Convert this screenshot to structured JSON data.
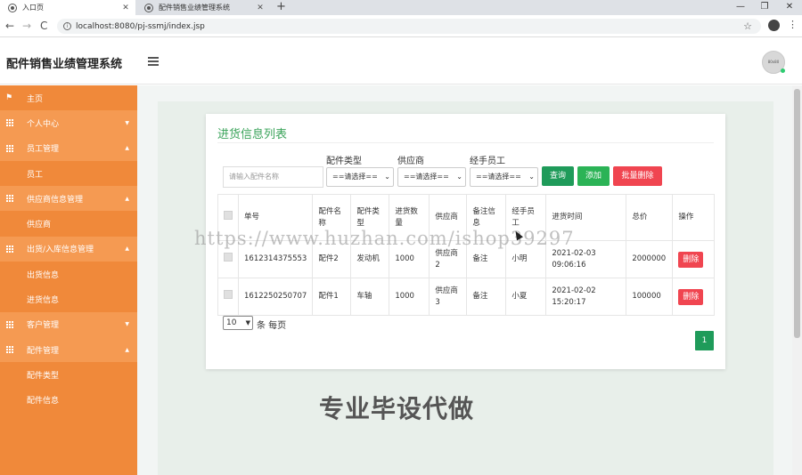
{
  "browser": {
    "tabs": [
      {
        "label": "入口页",
        "close": "✕"
      },
      {
        "label": "配件销售业绩管理系统",
        "close": "✕"
      }
    ],
    "new_tab": "+",
    "window_controls": [
      "—",
      "❐",
      "✕"
    ],
    "url": "localhost:8080/pj-ssmj/index.jsp",
    "back": "←",
    "forward": "→",
    "reload": "C",
    "star": "☆",
    "menu": "⋮"
  },
  "header": {
    "brand": "配件销售业绩管理系统",
    "avatar_text": "80x80"
  },
  "sidebar": {
    "items": [
      {
        "label": "主页",
        "icon": "flag-icon",
        "kind": "home"
      },
      {
        "label": "个人中心",
        "icon": "grid-icon",
        "kind": "group"
      },
      {
        "label": "员工管理",
        "icon": "grid-icon",
        "kind": "group"
      },
      {
        "label": "员工",
        "kind": "sub"
      },
      {
        "label": "供应商信息管理",
        "icon": "grid-icon",
        "kind": "group"
      },
      {
        "label": "供应商",
        "kind": "sub"
      },
      {
        "label": "出货/入库信息管理",
        "icon": "grid-icon",
        "kind": "group"
      },
      {
        "label": "出货信息",
        "kind": "sub"
      },
      {
        "label": "进货信息",
        "kind": "sub"
      },
      {
        "label": "客户管理",
        "icon": "grid-icon",
        "kind": "group"
      },
      {
        "label": "配件管理",
        "icon": "grid-icon",
        "kind": "group"
      },
      {
        "label": "配件类型",
        "kind": "sub"
      },
      {
        "label": "配件信息",
        "kind": "sub"
      }
    ]
  },
  "main": {
    "title": "进货信息列表",
    "filters": {
      "part_type_label": "配件类型",
      "supplier_label": "供应商",
      "staff_label": "经手员工",
      "search_placeholder": "请输入配件名称",
      "part_type_value": "==请选择==",
      "supplier_value": "==请选择==",
      "staff_value": "==请选择=="
    },
    "buttons": {
      "query": "查询",
      "add": "添加",
      "batch_delete": "批量删除"
    },
    "table": {
      "headers": [
        "单号",
        "配件名称",
        "配件类型",
        "进货数量",
        "供应商",
        "备注信息",
        "经手员工",
        "进货时间",
        "总价",
        "操作"
      ],
      "rows": [
        [
          "1612314375553",
          "配件2",
          "发动机",
          "1000",
          "供应商2",
          "备注",
          "小明",
          "2021-02-03 09:06:16",
          "2000000",
          "删除"
        ],
        [
          "1612250250707",
          "配件1",
          "车轴",
          "1000",
          "供应商3",
          "备注",
          "小夏",
          "2021-02-02 15:20:17",
          "100000",
          "删除"
        ]
      ]
    },
    "pagination": {
      "page_size": "10",
      "page_size_label": "条 每页",
      "current_page": "1"
    }
  },
  "watermarks": {
    "url": "https://www.huzhan.com/ishop39297",
    "cn": "专业毕设代做"
  },
  "colors": {
    "sidebar": "#f0893a",
    "sidebar_group": "#f59a52",
    "title_green": "#3aa35a",
    "query_btn": "#1f9b5a",
    "add_btn": "#2bb356",
    "danger": "#f04550"
  }
}
